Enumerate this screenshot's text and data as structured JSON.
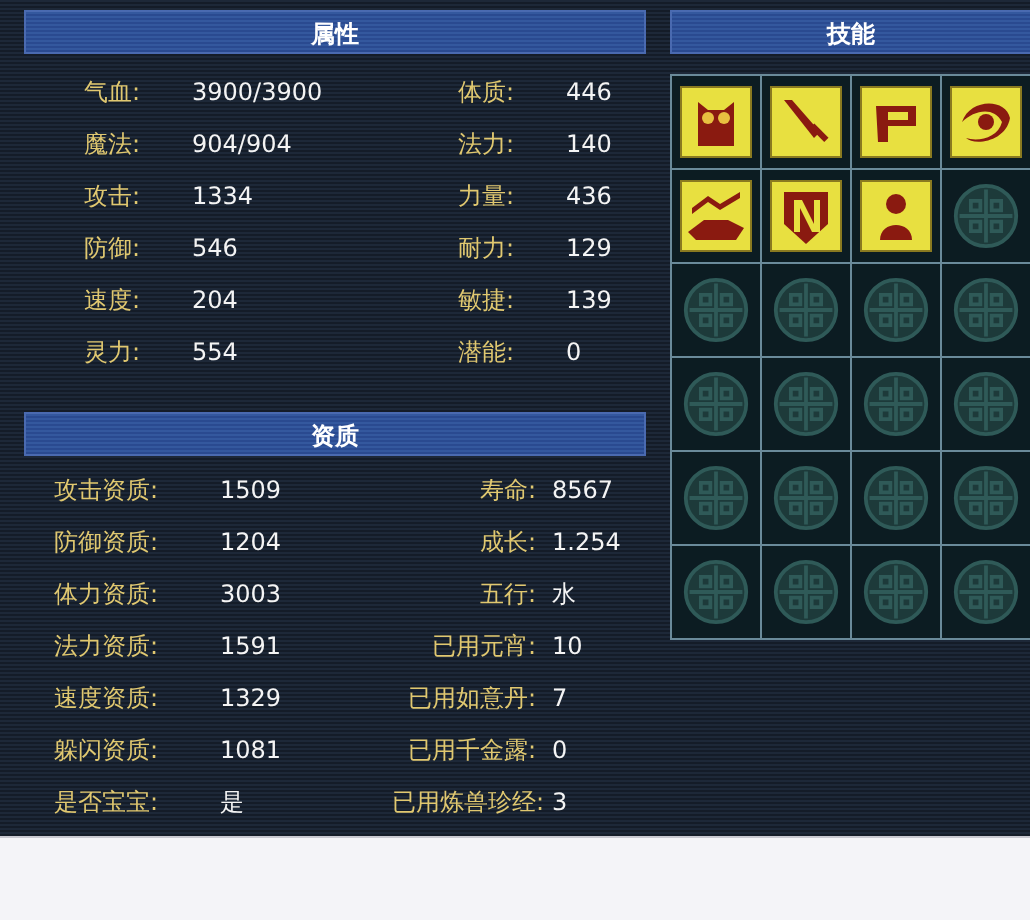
{
  "attributes": {
    "title": "属性",
    "rows": [
      {
        "left_label": "气血:",
        "left_value": "3900/3900",
        "right_label": "体质:",
        "right_value": "446"
      },
      {
        "left_label": "魔法:",
        "left_value": "904/904",
        "right_label": "法力:",
        "right_value": "140"
      },
      {
        "left_label": "攻击:",
        "left_value": "1334",
        "right_label": "力量:",
        "right_value": "436"
      },
      {
        "left_label": "防御:",
        "left_value": "546",
        "right_label": "耐力:",
        "right_value": "129"
      },
      {
        "left_label": "速度:",
        "left_value": "204",
        "right_label": "敏捷:",
        "right_value": "139"
      },
      {
        "left_label": "灵力:",
        "left_value": "554",
        "right_label": "潜能:",
        "right_value": "0"
      }
    ]
  },
  "aptitude": {
    "title": "资质",
    "rows": [
      {
        "left_label": "攻击资质:",
        "left_value": "1509",
        "right_label": "寿命:",
        "right_value": "8567"
      },
      {
        "left_label": "防御资质:",
        "left_value": "1204",
        "right_label": "成长:",
        "right_value": "1.254"
      },
      {
        "left_label": "体力资质:",
        "left_value": "3003",
        "right_label": "五行:",
        "right_value": "水"
      },
      {
        "left_label": "法力资质:",
        "left_value": "1591",
        "right_label": "已用元宵:",
        "right_value": "10"
      },
      {
        "left_label": "速度资质:",
        "left_value": "1329",
        "right_label": "已用如意丹:",
        "right_value": "7"
      },
      {
        "left_label": "躲闪资质:",
        "left_value": "1081",
        "right_label": "已用千金露:",
        "right_value": "0"
      },
      {
        "left_label": "是否宝宝:",
        "left_value": "是",
        "right_label": "已用炼兽珍经:",
        "right_value": "3"
      }
    ]
  },
  "skills": {
    "title": "技能",
    "slots": [
      {
        "kind": "skill"
      },
      {
        "kind": "skill"
      },
      {
        "kind": "skill"
      },
      {
        "kind": "skill"
      },
      {
        "kind": "skill"
      },
      {
        "kind": "skill"
      },
      {
        "kind": "skill"
      },
      {
        "kind": "empty"
      },
      {
        "kind": "empty"
      },
      {
        "kind": "empty"
      },
      {
        "kind": "empty"
      },
      {
        "kind": "empty"
      },
      {
        "kind": "empty"
      },
      {
        "kind": "empty"
      },
      {
        "kind": "empty"
      },
      {
        "kind": "empty"
      },
      {
        "kind": "empty"
      },
      {
        "kind": "empty"
      },
      {
        "kind": "empty"
      },
      {
        "kind": "empty"
      },
      {
        "kind": "empty"
      },
      {
        "kind": "empty"
      },
      {
        "kind": "empty"
      },
      {
        "kind": "empty"
      }
    ]
  }
}
